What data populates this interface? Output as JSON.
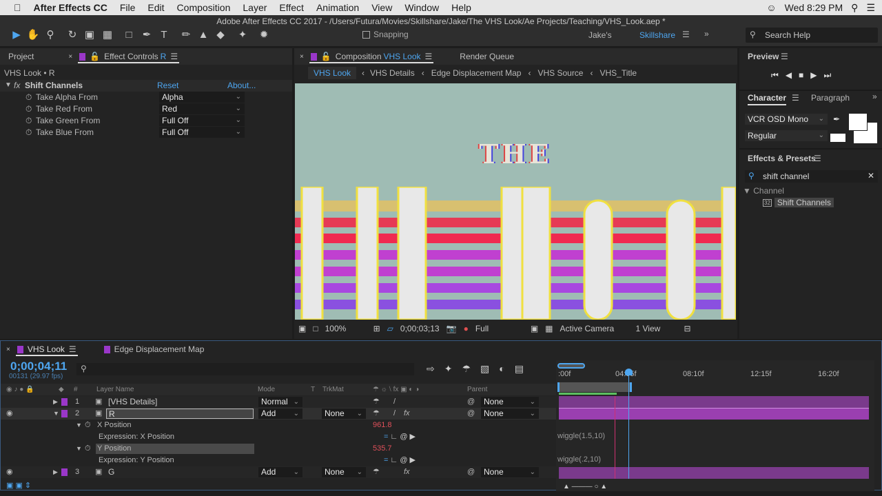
{
  "menubar": {
    "app": "After Effects CC",
    "items": [
      "File",
      "Edit",
      "Composition",
      "Layer",
      "Effect",
      "Animation",
      "View",
      "Window",
      "Help"
    ],
    "clock": "Wed 8:29 PM"
  },
  "window_title": "Adobe After Effects CC 2017 - /Users/Futura/Movies/Skillshare/Jake/The VHS Look/Ae Projects/Teaching/VHS_Look.aep *",
  "toolbar": {
    "snapping": "Snapping",
    "workspace_1": "Jake's",
    "workspace_2": "Skillshare",
    "search_placeholder": "Search Help"
  },
  "left_panel": {
    "tab_project": "Project",
    "tab_effect_prefix": "Effect Controls",
    "tab_effect_layer": "R",
    "breadcrumb": "VHS Look • R",
    "effect": {
      "name": "Shift Channels",
      "reset": "Reset",
      "about": "About...",
      "params": [
        {
          "label": "Take Alpha From",
          "value": "Alpha"
        },
        {
          "label": "Take Red From",
          "value": "Red"
        },
        {
          "label": "Take Green From",
          "value": "Full Off"
        },
        {
          "label": "Take Blue From",
          "value": "Full Off"
        }
      ]
    }
  },
  "comp_panel": {
    "tab_prefix": "Composition",
    "tab_comp": "VHS Look",
    "tab_render": "Render Queue",
    "breadcrumbs": [
      "VHS Look",
      "VHS Details",
      "Edge Displacement Map",
      "VHS Source",
      "VHS_Title"
    ],
    "viewer_text": "THE",
    "zoom": "100%",
    "timecode": "0;00;03;13",
    "resolution": "Full",
    "camera": "Active Camera",
    "views": "1 View"
  },
  "right_panel": {
    "preview": "Preview",
    "tab_character": "Character",
    "tab_paragraph": "Paragraph",
    "font": "VCR OSD Mono",
    "style": "Regular",
    "effects_presets": "Effects & Presets",
    "search_value": "shift channel",
    "category": "Channel",
    "result": "Shift Channels"
  },
  "timeline": {
    "tab_comp": "VHS Look",
    "tab_other": "Edge Displacement Map",
    "timecode": "0;00;04;11",
    "frame_info": "00131 (29.97 fps)",
    "headers": {
      "num": "#",
      "layer_name": "Layer Name",
      "mode": "Mode",
      "t": "T",
      "trkmat": "TrkMat",
      "parent": "Parent"
    },
    "ruler": [
      ":00f",
      "04:05f",
      "08:10f",
      "12:15f",
      "16:20f"
    ],
    "layers": [
      {
        "num": "1",
        "name": "[VHS Details]",
        "mode": "Normal",
        "trkmat": "",
        "parent": "None"
      },
      {
        "num": "2",
        "name": "R",
        "mode": "Add",
        "trkmat": "None",
        "parent": "None"
      },
      {
        "num": "3",
        "name": "G",
        "mode": "Add",
        "trkmat": "None",
        "parent": "None"
      }
    ],
    "props": [
      {
        "name": "X Position",
        "value": "961.8",
        "expr_label": "Expression: X Position",
        "expr": "wiggle(1.5,10)"
      },
      {
        "name": "Y Position",
        "value": "535.7",
        "expr_label": "Expression: Y Position",
        "expr": "wiggle(.2,10)"
      }
    ]
  },
  "colors": {
    "accent": "#4ea6f0",
    "label_purple": "#9a37c9",
    "value_red": "#e0505a",
    "viewer_bg": "#9fbcb4"
  }
}
